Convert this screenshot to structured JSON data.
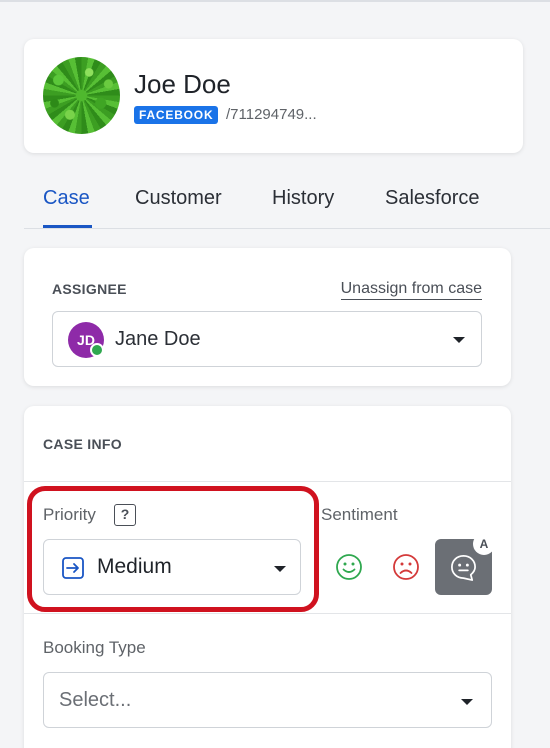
{
  "profile": {
    "name": "Joe Doe",
    "channel_badge": "FACEBOOK",
    "user_id": "/711294749..."
  },
  "tabs": [
    {
      "label": "Case",
      "active": true
    },
    {
      "label": "Customer",
      "active": false
    },
    {
      "label": "History",
      "active": false
    },
    {
      "label": "Salesforce",
      "active": false
    }
  ],
  "assignee": {
    "section_label": "ASSIGNEE",
    "unassign_label": "Unassign from case",
    "initials": "JD",
    "name": "Jane Doe"
  },
  "case_info": {
    "section_label": "CASE INFO",
    "priority": {
      "label": "Priority",
      "help_glyph": "?",
      "value": "Medium"
    },
    "sentiment": {
      "label": "Sentiment",
      "auto_badge": "A",
      "options": [
        "positive",
        "negative",
        "auto"
      ]
    },
    "booking_type": {
      "label": "Booking Type",
      "placeholder": "Select..."
    }
  },
  "colors": {
    "accent": "#1a56c4",
    "facebook": "#1a73e8",
    "highlight": "#d0121f",
    "positive": "#2fa84f",
    "negative": "#d43a3a",
    "avatar": "#8e2aa8"
  }
}
